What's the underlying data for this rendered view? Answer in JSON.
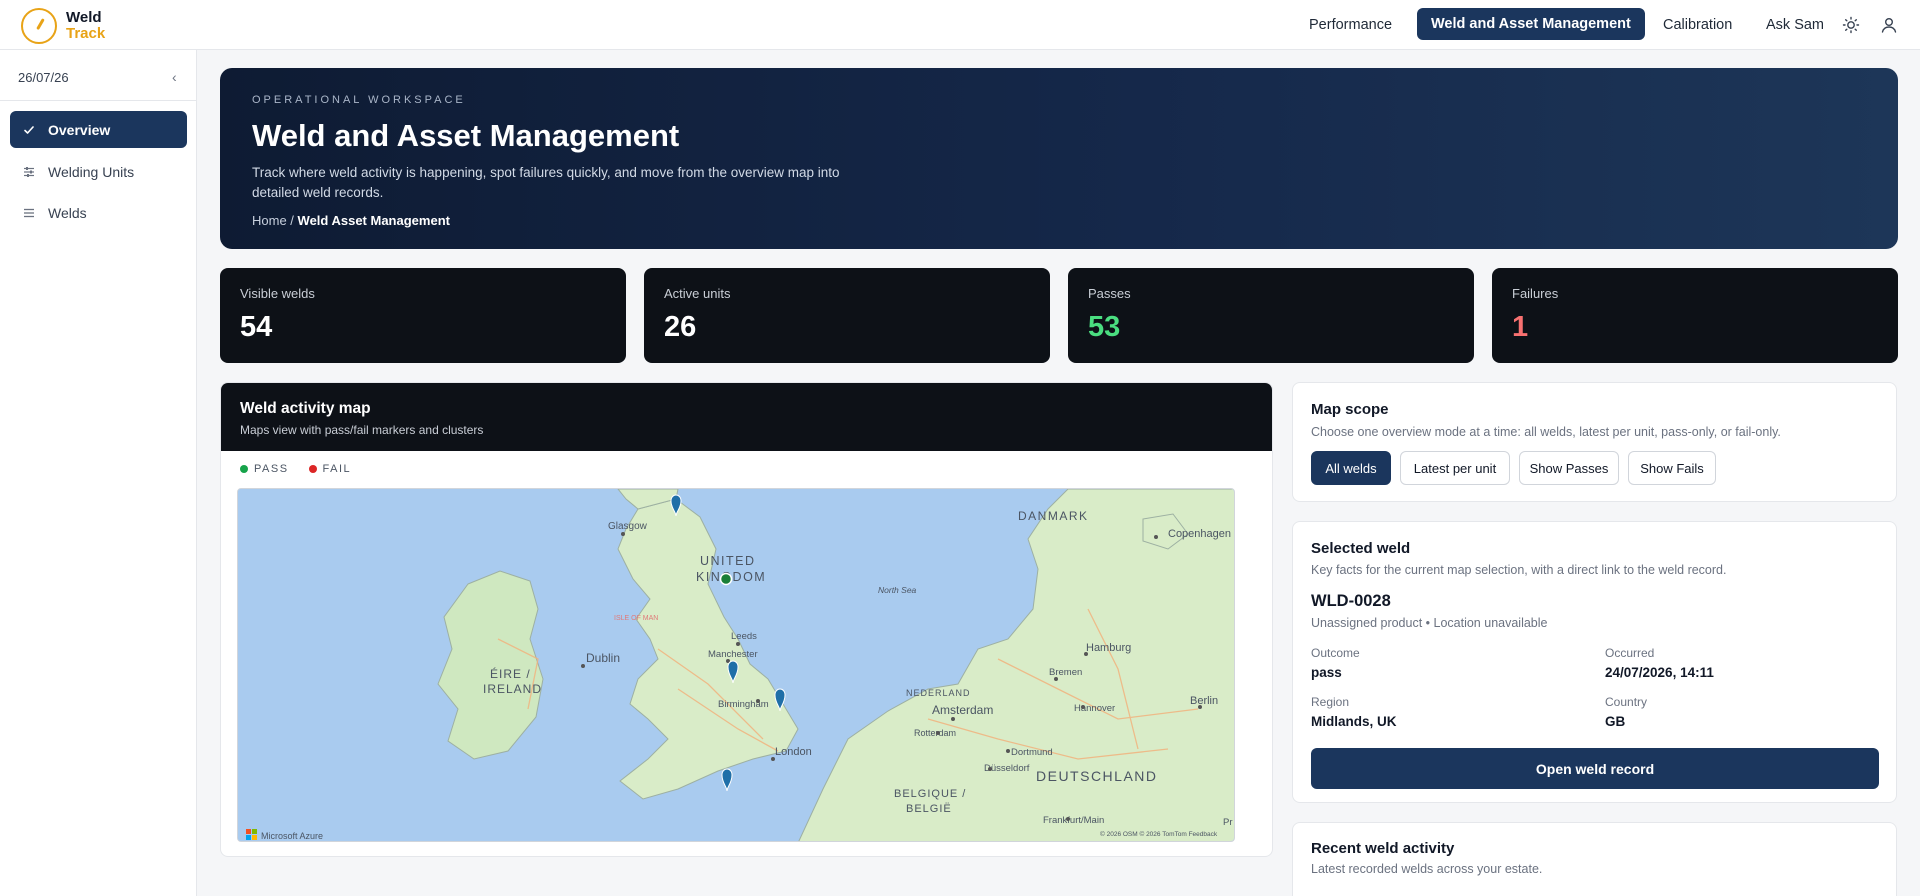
{
  "brand": {
    "line1": "Weld",
    "line2": "Track"
  },
  "nav": {
    "performance": "Performance",
    "weld_asset": "Weld and Asset Management",
    "calibration": "Calibration",
    "ask_sam": "Ask Sam",
    "theme_icon": "sun-icon",
    "user_icon": "user-icon"
  },
  "sidebar": {
    "date": "26/07/26",
    "collapse": "‹",
    "items": [
      {
        "label": "Overview",
        "icon": "check-icon"
      },
      {
        "label": "Welding Units",
        "icon": "sliders-icon"
      },
      {
        "label": "Welds",
        "icon": "list-icon"
      }
    ]
  },
  "hero": {
    "kicker": "OPERATIONAL WORKSPACE",
    "title": "Weld and Asset Management",
    "description": "Track where weld activity is happening, spot failures quickly, and move from the overview map into detailed weld records.",
    "breadcrumb_home": "Home /",
    "breadcrumb_current": "Weld Asset Management"
  },
  "stats": [
    {
      "label": "Visible welds",
      "value": "54",
      "color": "#ffffff"
    },
    {
      "label": "Active units",
      "value": "26",
      "color": "#ffffff"
    },
    {
      "label": "Passes",
      "value": "53",
      "color": "#4ade80"
    },
    {
      "label": "Failures",
      "value": "1",
      "color": "#f87171"
    }
  ],
  "map_panel": {
    "title": "Weld activity map",
    "subtitle": "Maps view with pass/fail markers and clusters",
    "legend_pass": "PASS",
    "legend_fail": "FAIL",
    "pass_color": "#16a34a",
    "fail_color": "#dc2626",
    "attribution": "Microsoft Azure",
    "copyright": "© 2026 OSM  © 2026 TomTom  Feedback",
    "labels": {
      "danmark": "DANMARK",
      "copenhagen": "Copenhagen",
      "glasgow": "Glasgow",
      "uk1": "UNITED",
      "uk2": "KINGDOM",
      "north_sea": "North Sea",
      "isle_of_man": "ISLE OF MAN",
      "leeds": "Leeds",
      "manchester": "Manchester",
      "dublin": "Dublin",
      "eire1": "ÉIRE /",
      "eire2": "IRELAND",
      "birmingham": "Birmingham",
      "london": "London",
      "nederland": "NEDERLAND",
      "amsterdam": "Amsterdam",
      "rotterdam": "Rotterdam",
      "hamburg": "Hamburg",
      "bremen": "Bremen",
      "hannover": "Hannover",
      "berlin": "Berlin",
      "dortmund": "Dortmund",
      "dusseldorf": "Düsseldorf",
      "deutschland": "DEUTSCHLAND",
      "belgique1": "BELGIQUE /",
      "belgique2": "BELGIË",
      "frankfurt": "Frankfurt/Main",
      "pr": "Pr"
    }
  },
  "map_scope": {
    "title": "Map scope",
    "subtitle": "Choose one overview mode at a time: all welds, latest per unit, pass-only, or fail-only.",
    "buttons": [
      "All welds",
      "Latest per unit",
      "Show Passes",
      "Show Fails"
    ],
    "selected": "All welds"
  },
  "selected_weld": {
    "title": "Selected weld",
    "subtitle": "Key facts for the current map selection, with a direct link to the weld record.",
    "id": "WLD-0028",
    "meta": "Unassigned product • Location unavailable",
    "outcome_label": "Outcome",
    "outcome_value": "pass",
    "occurred_label": "Occurred",
    "occurred_value": "24/07/2026, 14:11",
    "region_label": "Region",
    "region_value": "Midlands, UK",
    "country_label": "Country",
    "country_value": "GB",
    "open_button": "Open weld record"
  },
  "recent": {
    "title": "Recent weld activity",
    "subtitle": "Latest recorded welds across your estate."
  }
}
